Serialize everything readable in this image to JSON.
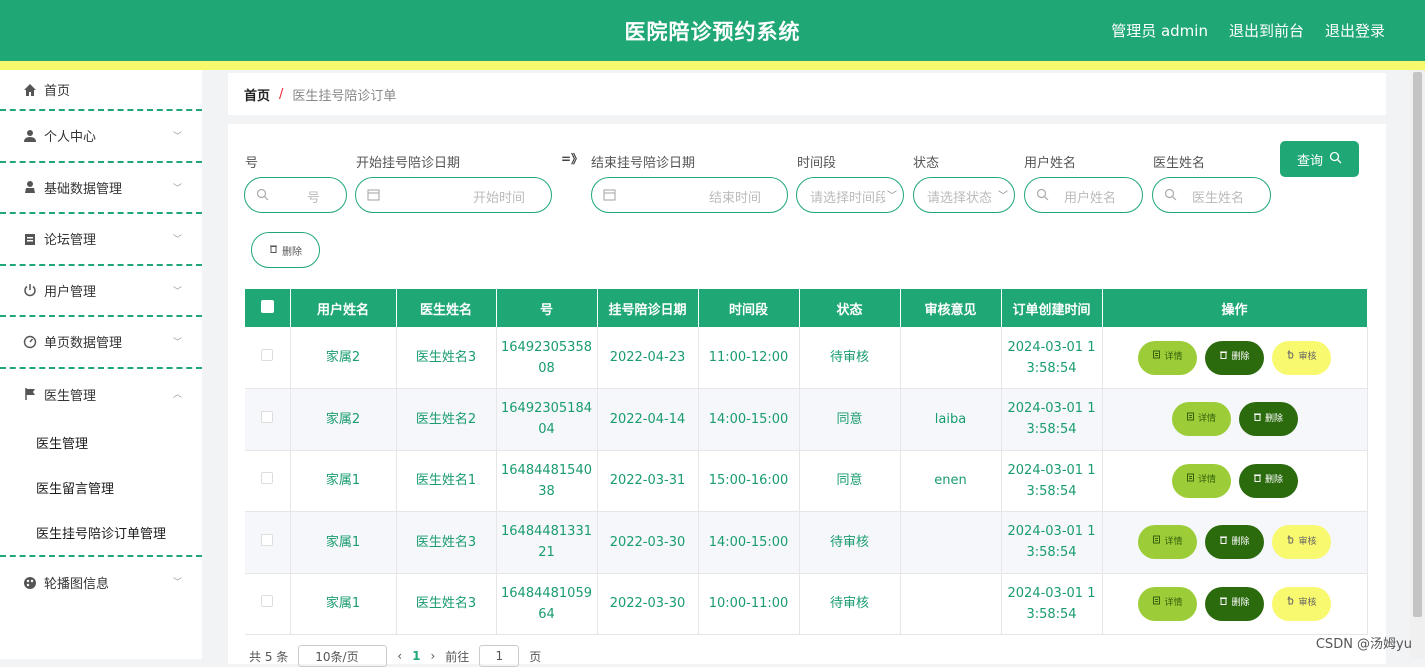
{
  "header": {
    "title": "医院陪诊预约系统",
    "admin_label": "管理员 admin",
    "back_front": "退出到前台",
    "logout": "退出登录"
  },
  "sidebar": {
    "items": [
      {
        "label": "首页",
        "icon": "home-icon"
      },
      {
        "label": "个人中心",
        "icon": "user-icon"
      },
      {
        "label": "基础数据管理",
        "icon": "user-alt-icon"
      },
      {
        "label": "论坛管理",
        "icon": "clipboard-icon"
      },
      {
        "label": "用户管理",
        "icon": "power-icon"
      },
      {
        "label": "单页数据管理",
        "icon": "gauge-icon"
      },
      {
        "label": "医生管理",
        "icon": "flag-icon"
      }
    ],
    "sub_items": [
      "医生管理",
      "医生留言管理",
      "医生挂号陪诊订单管理"
    ],
    "last_item": {
      "label": "轮播图信息",
      "icon": "palette-icon"
    }
  },
  "breadcrumb": {
    "home": "首页",
    "separator": "/",
    "current": "医生挂号陪诊订单"
  },
  "filters": {
    "labels": [
      "号",
      "开始挂号陪诊日期",
      "结束挂号陪诊日期",
      "时间段",
      "状态",
      "用户姓名",
      "医生姓名"
    ],
    "arrow": "=》",
    "placeholders": {
      "number": "号",
      "start": "开始时间",
      "end": "结束时间",
      "period": "请选择时间段",
      "status": "请选择状态",
      "user": "用户姓名",
      "doctor": "医生姓名"
    },
    "query_button": "查询",
    "delete_button": "删除"
  },
  "table": {
    "headers": [
      "用户姓名",
      "医生姓名",
      "号",
      "挂号陪诊日期",
      "时间段",
      "状态",
      "审核意见",
      "订单创建时间",
      "操作"
    ],
    "rows": [
      {
        "user": "家属2",
        "doctor": "医生姓名3",
        "number": "1649230535808",
        "date": "2022-04-23",
        "period": "11:00-12:00",
        "status": "待审核",
        "opinion": "",
        "created": "2024-03-01 13:58:54",
        "audit": true
      },
      {
        "user": "家属2",
        "doctor": "医生姓名2",
        "number": "1649230518404",
        "date": "2022-04-14",
        "period": "14:00-15:00",
        "status": "同意",
        "opinion": "laiba",
        "created": "2024-03-01 13:58:54",
        "audit": false
      },
      {
        "user": "家属1",
        "doctor": "医生姓名1",
        "number": "1648448154038",
        "date": "2022-03-31",
        "period": "15:00-16:00",
        "status": "同意",
        "opinion": "enen",
        "created": "2024-03-01 13:58:54",
        "audit": false
      },
      {
        "user": "家属1",
        "doctor": "医生姓名3",
        "number": "1648448133121",
        "date": "2022-03-30",
        "period": "14:00-15:00",
        "status": "待审核",
        "opinion": "",
        "created": "2024-03-01 13:58:54",
        "audit": true
      },
      {
        "user": "家属1",
        "doctor": "医生姓名3",
        "number": "1648448105964",
        "date": "2022-03-30",
        "period": "10:00-11:00",
        "status": "待审核",
        "opinion": "",
        "created": "2024-03-01 13:58:54",
        "audit": true
      }
    ],
    "op_labels": {
      "detail": "详情",
      "delete": "删除",
      "audit": "审核"
    }
  },
  "pager": {
    "total": "共 5 条",
    "page_size": "10条/页",
    "current_page": "1",
    "goto_label": "前往",
    "goto_value": "1",
    "page_suffix": "页"
  },
  "watermark": "CSDN @汤姆yu"
}
